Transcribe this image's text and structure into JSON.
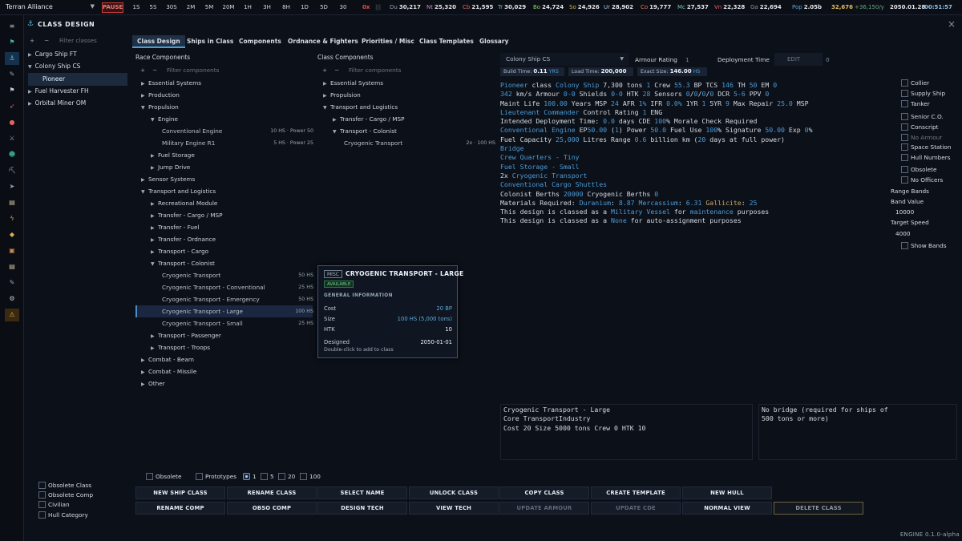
{
  "topbar": {
    "empire": "Terran Alliance",
    "pause": "PAUSE",
    "timesteps": [
      "1S",
      "5S",
      "30S",
      "2M",
      "5M",
      "20M",
      "1H",
      "3H",
      "8H",
      "1D",
      "5D",
      "30"
    ],
    "resources": [
      {
        "code": "0x",
        "value": ""
      },
      {
        "code": "Du",
        "value": "30,217"
      },
      {
        "code": "Nt",
        "value": "25,320"
      },
      {
        "code": "Cb",
        "value": "21,595"
      },
      {
        "code": "Tr",
        "value": "30,029"
      },
      {
        "code": "Bo",
        "value": "24,724"
      },
      {
        "code": "So",
        "value": "24,926"
      },
      {
        "code": "Ur",
        "value": "28,902"
      },
      {
        "code": "Co",
        "value": "19,777"
      },
      {
        "code": "Mc",
        "value": "27,537"
      },
      {
        "code": "Vn",
        "value": "22,328"
      },
      {
        "code": "Ga",
        "value": "22,694"
      },
      {
        "code": "Pop",
        "value": "2.05b"
      }
    ],
    "wealth": "32,676",
    "wealth_delta": "+36,150/y",
    "date": "2050.01.28",
    "time": "00:51:57"
  },
  "window": {
    "title": "CLASS DESIGN",
    "close": "×"
  },
  "classlist": {
    "filter_placeholder": "Filter classes",
    "items": [
      {
        "label": "Cargo Ship FT",
        "expanded": false
      },
      {
        "label": "Colony Ship CS",
        "expanded": true
      },
      {
        "label": "Pioneer",
        "selected": true
      },
      {
        "label": "Fuel Harvester FH",
        "expanded": false
      },
      {
        "label": "Orbital Miner OM",
        "expanded": false
      }
    ]
  },
  "tabs": [
    "Class Design",
    "Ships in Class",
    "Components",
    "Ordnance & Fighters",
    "Priorities / Misc",
    "Class Templates",
    "Glossary"
  ],
  "race_components": {
    "header": "Race Components",
    "filter_placeholder": "Filter components",
    "rows": [
      {
        "label": "Essential Systems",
        "arrow": "▶",
        "level": 0
      },
      {
        "label": "Production",
        "arrow": "▶",
        "level": 0
      },
      {
        "label": "Propulsion",
        "arrow": "▼",
        "level": 0
      },
      {
        "label": "Engine",
        "arrow": "▼",
        "level": 1
      },
      {
        "label": "Conventional Engine",
        "arrow": "",
        "level": 2,
        "right": "10 HS · Power 50"
      },
      {
        "label": "Military Engine R1",
        "arrow": "",
        "level": 2,
        "right": "5 HS · Power 25"
      },
      {
        "label": "Fuel Storage",
        "arrow": "▶",
        "level": 1
      },
      {
        "label": "Jump Drive",
        "arrow": "▶",
        "level": 1
      },
      {
        "label": "Sensor Systems",
        "arrow": "▶",
        "level": 0
      },
      {
        "label": "Transport and Logistics",
        "arrow": "▼",
        "level": 0
      },
      {
        "label": "Recreational Module",
        "arrow": "▶",
        "level": 1
      },
      {
        "label": "Transfer - Cargo / MSP",
        "arrow": "▶",
        "level": 1
      },
      {
        "label": "Transfer - Fuel",
        "arrow": "▶",
        "level": 1
      },
      {
        "label": "Transfer - Ordnance",
        "arrow": "▶",
        "level": 1
      },
      {
        "label": "Transport - Cargo",
        "arrow": "▶",
        "level": 1
      },
      {
        "label": "Transport - Colonist",
        "arrow": "▼",
        "level": 1
      },
      {
        "label": "Cryogenic Transport",
        "arrow": "",
        "level": 2,
        "right": "50 HS"
      },
      {
        "label": "Cryogenic Transport - Conventional",
        "arrow": "",
        "level": 2,
        "right": "25 HS"
      },
      {
        "label": "Cryogenic Transport - Emergency",
        "arrow": "",
        "level": 2,
        "right": "50 HS"
      },
      {
        "label": "Cryogenic Transport - Large",
        "arrow": "",
        "level": 2,
        "right": "100 HS",
        "selected": true
      },
      {
        "label": "Cryogenic Transport - Small",
        "arrow": "",
        "level": 2,
        "right": "25 HS"
      },
      {
        "label": "Transport - Passenger",
        "arrow": "▶",
        "level": 1
      },
      {
        "label": "Transport - Troops",
        "arrow": "▶",
        "level": 1
      },
      {
        "label": "Combat - Beam",
        "arrow": "▶",
        "level": 0
      },
      {
        "label": "Combat - Missile",
        "arrow": "▶",
        "level": 0
      },
      {
        "label": "Other",
        "arrow": "▶",
        "level": 0
      }
    ]
  },
  "class_components": {
    "header": "Class Components",
    "filter_placeholder": "Filter components",
    "rows": [
      {
        "label": "Essential Systems",
        "arrow": "▶",
        "level": 0
      },
      {
        "label": "Propulsion",
        "arrow": "▶",
        "level": 0
      },
      {
        "label": "Transport and Logistics",
        "arrow": "▼",
        "level": 0
      },
      {
        "label": "Transfer - Cargo / MSP",
        "arrow": "▶",
        "level": 1
      },
      {
        "label": "Transport - Colonist",
        "arrow": "▼",
        "level": 1
      },
      {
        "label": "Cryogenic Transport",
        "arrow": "",
        "level": 2,
        "right": "2x · 100 HS"
      }
    ]
  },
  "tooltip": {
    "badge": "MISC",
    "title": "CRYOGENIC TRANSPORT - LARGE",
    "status": "AVAILABLE",
    "section": "GENERAL INFORMATION",
    "rows": [
      {
        "label": "Cost",
        "value": "20 BP"
      },
      {
        "label": "Size",
        "value": "100 HS (5,000 tons)"
      },
      {
        "label": "HTK",
        "value": "10"
      },
      {
        "label": "Designed",
        "value": "2050-01-01"
      }
    ],
    "hint": "Double-click to add to class"
  },
  "design_bar": {
    "class_select": "Colony Ship  CS",
    "armour_label": "Armour Rating",
    "armour_value": "1",
    "deploy_label": "Deployment Time",
    "deploy_edit": "EDIT",
    "deploy_value": "0",
    "build_time_label": "Build Time:",
    "build_time_value": "0.11",
    "build_time_unit": "YRS",
    "load_time_label": "Load Time:",
    "load_time_value": "200,000",
    "exact_size_label": "Exact Size:",
    "exact_size_value": "146.00",
    "exact_size_unit": "HS"
  },
  "summary": {
    "l1": [
      "Pioneer",
      " class ",
      "Colony Ship",
      "      7,300",
      " tons       ",
      "1",
      " Crew        ",
      "55.3",
      " BP      TCS ",
      "146",
      "    TH ",
      "50",
      "    EM ",
      "0"
    ],
    "l2": [
      "342",
      " km/s       Armour ",
      "0-0",
      "       Shields ",
      "0-0",
      "       HTK ",
      "28",
      "      Sensors ",
      "0",
      "/",
      "0",
      "/",
      "0",
      "/",
      "0",
      "      DCR ",
      "5-6",
      "     PPV ",
      "0"
    ],
    "l3": [
      "Maint Life ",
      "100.00",
      " Years     MSP ",
      "24",
      "    AFR ",
      "1%",
      "     IFR ",
      "0.0%",
      "    1YR ",
      "1",
      "     5YR ",
      "9",
      "    Max Repair ",
      "25.0",
      " MSP"
    ],
    "l4": [
      "Lieutenant Commander",
      "    Control Rating ",
      "1",
      "   ENG"
    ],
    "l5": [
      "Intended Deployment Time: ",
      "0.0",
      " days    CDE ",
      "100",
      "%     Morale Check Required"
    ],
    "l6": [
      "Conventional Engine",
      " EP",
      "50.00",
      " (",
      "1",
      ")     Power ",
      "50.0",
      "     Fuel Use ",
      "100",
      "%     Signature ",
      "50.00",
      "     Exp ",
      "0",
      "%"
    ],
    "l7": [
      "Fuel Capacity ",
      "25,000",
      " Litres     Range ",
      "0.6",
      " billion km (",
      "20",
      " days at full power)"
    ],
    "l8": "Bridge",
    "l9": "Crew Quarters - Tiny",
    "l10": "Fuel Storage - Small",
    "l11": [
      "2x ",
      "Cryogenic Transport"
    ],
    "l12": "Conventional Cargo Shuttles",
    "l13": [
      "Colonist Berths ",
      "20000",
      "     Cryogenic Berths ",
      "0"
    ],
    "l14": [
      "Materials Required: ",
      "Duranium",
      ": ",
      "8.87",
      "   ",
      "Mercassium",
      ": ",
      "6.31",
      "   ",
      "Gallicite",
      ": ",
      "25"
    ],
    "l15": [
      "This design is classed as a ",
      "Military Vessel",
      " for ",
      "maintenance",
      " purposes"
    ],
    "l16": [
      "This design is classed as a ",
      "None",
      " for auto-assignment purposes"
    ]
  },
  "right_options": {
    "checks": [
      "Collier",
      "Supply Ship",
      "Tanker",
      "Senior C.O.",
      "Conscript",
      "No Armour",
      "Space Station",
      "Hull Numbers",
      "Obsolete",
      "No Officers"
    ],
    "range_bands_label": "Range Bands",
    "band_value_label": "Band Value",
    "band_value": "10000",
    "target_speed_label": "Target Speed",
    "target_speed": "4000",
    "show_bands": "Show Bands"
  },
  "detail_left": [
    "Cryogenic Transport - Large",
    "Core TransportIndustry",
    "Cost 20   Size 5000 tons   Crew 0   HTK 10"
  ],
  "detail_right": [
    "No bridge (required for ships of",
    "500 tons or more)"
  ],
  "bottom_filters": {
    "obsolete": "Obsolete",
    "prototypes": "Prototypes",
    "radio": [
      "1",
      "5",
      "20",
      "100"
    ]
  },
  "left_bottom_checks": [
    "Obsolete Class",
    "Obsolete Comp",
    "Civilian",
    "Hull Category"
  ],
  "buttons_row1": [
    "NEW SHIP CLASS",
    "RENAME CLASS",
    "SELECT NAME",
    "UNLOCK CLASS",
    "COPY CLASS",
    "CREATE TEMPLATE",
    "NEW HULL"
  ],
  "buttons_row2": [
    "RENAME COMP",
    "OBSO COMP",
    "DESIGN TECH",
    "VIEW TECH",
    "UPDATE ARMOUR",
    "UPDATE CDE",
    "NORMAL VIEW",
    "DELETE CLASS"
  ],
  "footer": "ENGINE  0.1.0-alpha",
  "colors": {
    "accent": "#4b9cd8",
    "pause": "#c2403e",
    "available": "#6fd08e",
    "bg": "#0c1019"
  },
  "left_strip_icons": [
    "flag-icon",
    "anchor-icon",
    "wrench-icon",
    "flag-small-icon",
    "rocket-icon",
    "target-icon",
    "swords-icon",
    "person-icon",
    "pickaxe-icon",
    "ship-icon",
    "clipboard-icon",
    "bolt-icon",
    "tag-icon",
    "box-icon",
    "clipboard2-icon",
    "tool-icon",
    "gear-icon",
    "warning-icon"
  ]
}
